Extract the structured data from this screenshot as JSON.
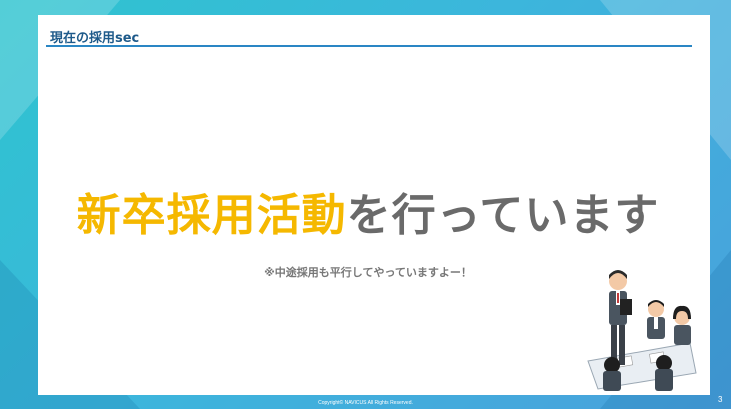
{
  "slide": {
    "header_title": "現在の採用sec",
    "headline_accent": "新卒採用活動",
    "headline_rest": "を行っています",
    "subnote": "※中途採用も平行してやっていますよー！",
    "illustration": "business-meeting-illustration",
    "footer": "Copyright© NAVICUS All Rights Reserved.",
    "page_number": "3"
  },
  "colors": {
    "accent": "#f5b800",
    "title_blue": "#1e5a8a",
    "rule_blue": "#2a86c4",
    "text_gray": "#6a6a6a"
  }
}
